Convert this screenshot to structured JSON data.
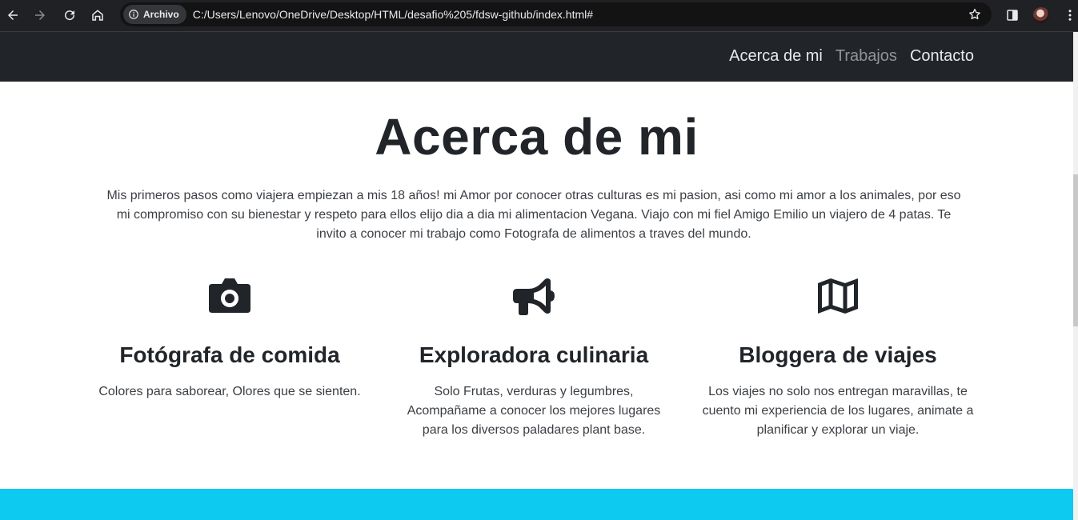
{
  "browser": {
    "site_chip": "Archivo",
    "url": "C:/Users/Lenovo/OneDrive/Desktop/HTML/desafio%205/fdsw-github/index.html#"
  },
  "navbar": {
    "links": [
      "Acerca de mi",
      "Trabajos",
      "Contacto"
    ]
  },
  "about": {
    "title": "Acerca de mi",
    "intro_lines": [
      "Mis primeros pasos como viajera empiezan a mis 18 años! mi Amor por conocer otras culturas es mi pasion, asi como mi amor a los animales, por eso",
      "mi compromiso con su bienestar y respeto para ellos elijo dia a dia mi alimentacion Vegana. Viajo con mi fiel Amigo Emilio un viajero de 4 patas. Te",
      "invito a conocer mi trabajo como Fotografa de alimentos a traves del mundo."
    ],
    "features": [
      {
        "icon": "camera-icon",
        "title": "Fotógrafa de comida",
        "lines": [
          "Colores para saborear, Olores que se sienten."
        ]
      },
      {
        "icon": "megaphone-icon",
        "title": "Exploradora culinaria",
        "lines": [
          "Solo Frutas, verduras y legumbres,",
          "Acompañame a conocer los mejores lugares",
          "para los diversos paladares plant base."
        ]
      },
      {
        "icon": "map-icon",
        "title": "Bloggera de viajes",
        "lines": [
          "Los viajes no solo nos entregan maravillas, te",
          "cuento mi experiencia de los lugares, animate a",
          "planificar y explorar un viaje."
        ]
      }
    ]
  },
  "colors": {
    "navbar_bg": "#212529",
    "band_accent": "#0dcaf0",
    "text": "#212529"
  }
}
